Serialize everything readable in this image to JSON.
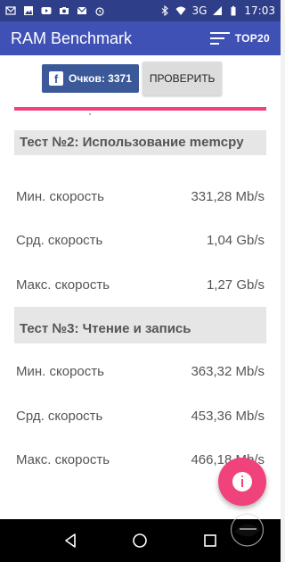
{
  "status_bar": {
    "network": "3G",
    "time": "17:03"
  },
  "app_bar": {
    "title": "RAM Benchmark",
    "top_label": "TOP20"
  },
  "actions": {
    "score_label": "Очков: 3371",
    "check_label": "ПРОВЕРИТЬ"
  },
  "sections": [
    {
      "title": "Тест №2: Использование memcpy",
      "rows": [
        {
          "label": "Мин. скорость",
          "value": "331,28 Mb/s"
        },
        {
          "label": "Срд. скорость",
          "value": "1,04 Gb/s"
        },
        {
          "label": "Макс. скорость",
          "value": "1,27 Gb/s"
        }
      ]
    },
    {
      "title": "Тест №3: Чтение и запись",
      "rows": [
        {
          "label": "Мин. скорость",
          "value": "363,32 Mb/s"
        },
        {
          "label": "Срд. скорость",
          "value": "453,36 Mb/s"
        },
        {
          "label": "Макс. скорость",
          "value": "466,18 Mb/s"
        }
      ]
    }
  ],
  "colors": {
    "primary": "#3f51b5",
    "status_bar": "#2f3e88",
    "accent": "#f0437c",
    "facebook": "#3b5998"
  },
  "icons": [
    "envelope-icon",
    "image-icon",
    "youtube-icon",
    "camera-icon",
    "mail-icon",
    "alarm-icon",
    "bluetooth-icon",
    "wifi-icon",
    "signal-icon",
    "battery-icon",
    "list-icon",
    "facebook-icon",
    "info-icon",
    "back-icon",
    "home-icon",
    "recents-icon",
    "watermark-logo"
  ]
}
